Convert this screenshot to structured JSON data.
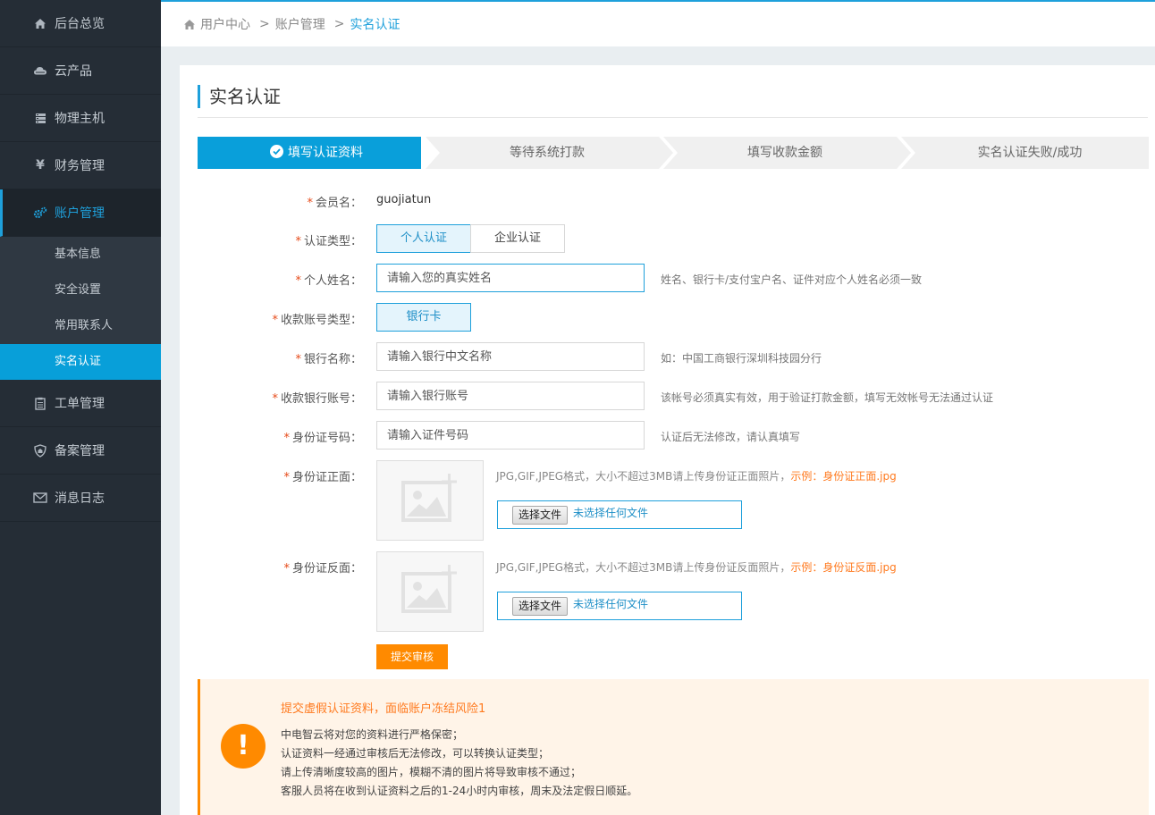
{
  "sidebar": {
    "items": [
      {
        "label": "后台总览",
        "icon": "home-icon"
      },
      {
        "label": "云产品",
        "icon": "cloud-icon"
      },
      {
        "label": "物理主机",
        "icon": "server-icon"
      },
      {
        "label": "财务管理",
        "icon": "yen-icon"
      },
      {
        "label": "账户管理",
        "icon": "gears-icon",
        "active": true
      },
      {
        "label": "工单管理",
        "icon": "clipboard-icon"
      },
      {
        "label": "备案管理",
        "icon": "shield-icon"
      },
      {
        "label": "消息日志",
        "icon": "envelope-icon"
      }
    ],
    "sub_items": [
      {
        "label": "基本信息"
      },
      {
        "label": "安全设置"
      },
      {
        "label": "常用联系人"
      },
      {
        "label": "实名认证",
        "active": true
      }
    ]
  },
  "breadcrumb": {
    "items": [
      "用户中心",
      "账户管理",
      "实名认证"
    ],
    "separator": ">"
  },
  "page": {
    "title": "实名认证"
  },
  "steps": [
    {
      "label": "填写认证资料",
      "active": true
    },
    {
      "label": "等待系统打款"
    },
    {
      "label": "填写收款金额"
    },
    {
      "label": "实名认证失败/成功"
    }
  ],
  "form": {
    "required_mark": "*",
    "member": {
      "label": "会员名：",
      "value": "guojiatun"
    },
    "cert_type": {
      "label": "认证类型：",
      "options": [
        "个人认证",
        "企业认证"
      ],
      "selected": "个人认证"
    },
    "name": {
      "label": "个人姓名：",
      "placeholder": "请输入您的真实姓名",
      "hint": "姓名、银行卡/支付宝户名、证件对应个人姓名必须一致"
    },
    "account_type": {
      "label": "收款账号类型：",
      "option": "银行卡"
    },
    "bank_name": {
      "label": "银行名称：",
      "placeholder": "请输入银行中文名称",
      "hint": "如：中国工商银行深圳科技园分行"
    },
    "bank_account": {
      "label": "收款银行账号：",
      "placeholder": "请输入银行账号",
      "hint": "该帐号必须真实有效，用于验证打款金额，填写无效帐号无法通过认证"
    },
    "id_number": {
      "label": "身份证号码：",
      "placeholder": "请输入证件号码",
      "hint": "认证后无法修改，请认真填写"
    },
    "id_front": {
      "label": "身份证正面：",
      "hint": "JPG,GIF,JPEG格式，大小不超过3MB请上传身份证正面照片，",
      "example": "示例：身份证正面.jpg",
      "button": "选择文件",
      "status": "未选择任何文件"
    },
    "id_back": {
      "label": "身份证反面：",
      "hint": "JPG,GIF,JPEG格式，大小不超过3MB请上传身份证反面照片，",
      "example": "示例：身份证反面.jpg",
      "button": "选择文件",
      "status": "未选择任何文件"
    },
    "submit": "提交审核"
  },
  "warning": {
    "icon": "!",
    "title": "提交虚假认证资料，面临账户冻结风险1",
    "lines": [
      "中电智云将对您的资料进行严格保密；",
      "认证资料一经通过审核后无法修改，可以转换认证类型；",
      "请上传清晰度较高的图片，模糊不清的图片将导致审核不通过；",
      "客服人员将在收到认证资料之后的1-24小时内审核，周末及法定假日顺延。"
    ]
  },
  "colors": {
    "accent": "#1ea0db",
    "sidebar_bg": "#252d36",
    "submit": "#ff8a00",
    "warning_bg": "#fff4e8"
  }
}
